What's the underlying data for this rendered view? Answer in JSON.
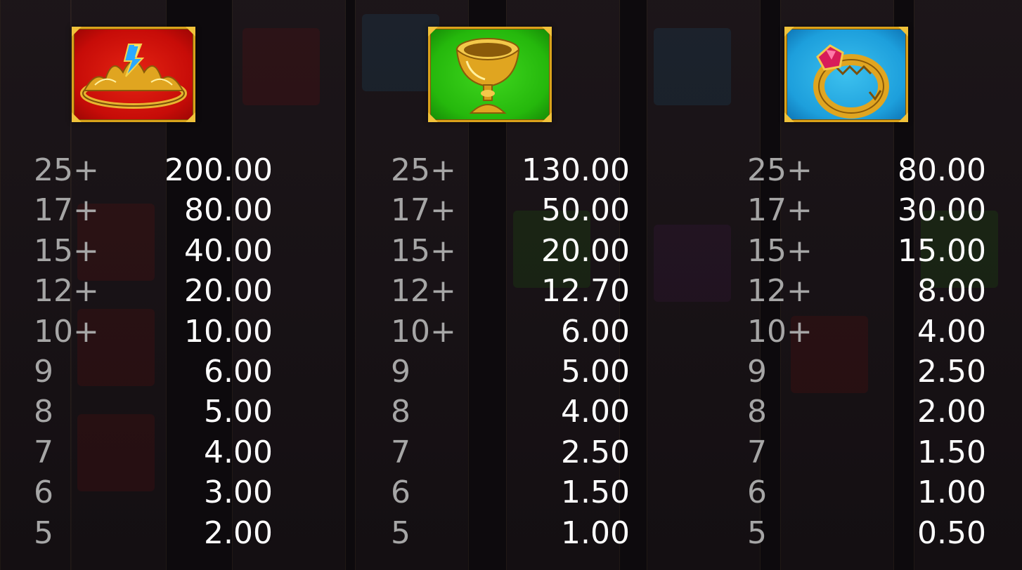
{
  "colors": {
    "background": "#0d0a0d",
    "count_text": "#a6a6a6",
    "value_text": "#ffffff",
    "frame_gold": "#d9a21b",
    "tile_red": "#c70c08",
    "tile_green": "#25b80c",
    "tile_blue": "#1d9fdc"
  },
  "paytable": [
    {
      "symbol": "crown-icon",
      "tile_color": "red",
      "rows": [
        {
          "count": "25+",
          "value": "200.00"
        },
        {
          "count": "17+",
          "value": "80.00"
        },
        {
          "count": "15+",
          "value": "40.00"
        },
        {
          "count": "12+",
          "value": "20.00"
        },
        {
          "count": "10+",
          "value": "10.00"
        },
        {
          "count": "9",
          "value": "6.00"
        },
        {
          "count": "8",
          "value": "5.00"
        },
        {
          "count": "7",
          "value": "4.00"
        },
        {
          "count": "6",
          "value": "3.00"
        },
        {
          "count": "5",
          "value": "2.00"
        }
      ]
    },
    {
      "symbol": "chalice-icon",
      "tile_color": "green",
      "rows": [
        {
          "count": "25+",
          "value": "130.00"
        },
        {
          "count": "17+",
          "value": "50.00"
        },
        {
          "count": "15+",
          "value": "20.00"
        },
        {
          "count": "12+",
          "value": "12.70"
        },
        {
          "count": "10+",
          "value": "6.00"
        },
        {
          "count": "9",
          "value": "5.00"
        },
        {
          "count": "8",
          "value": "4.00"
        },
        {
          "count": "7",
          "value": "2.50"
        },
        {
          "count": "6",
          "value": "1.50"
        },
        {
          "count": "5",
          "value": "1.00"
        }
      ]
    },
    {
      "symbol": "ring-icon",
      "tile_color": "blue",
      "rows": [
        {
          "count": "25+",
          "value": "80.00"
        },
        {
          "count": "17+",
          "value": "30.00"
        },
        {
          "count": "15+",
          "value": "15.00"
        },
        {
          "count": "12+",
          "value": "8.00"
        },
        {
          "count": "10+",
          "value": "4.00"
        },
        {
          "count": "9",
          "value": "2.50"
        },
        {
          "count": "8",
          "value": "2.00"
        },
        {
          "count": "7",
          "value": "1.50"
        },
        {
          "count": "6",
          "value": "1.00"
        },
        {
          "count": "5",
          "value": "0.50"
        }
      ]
    }
  ]
}
